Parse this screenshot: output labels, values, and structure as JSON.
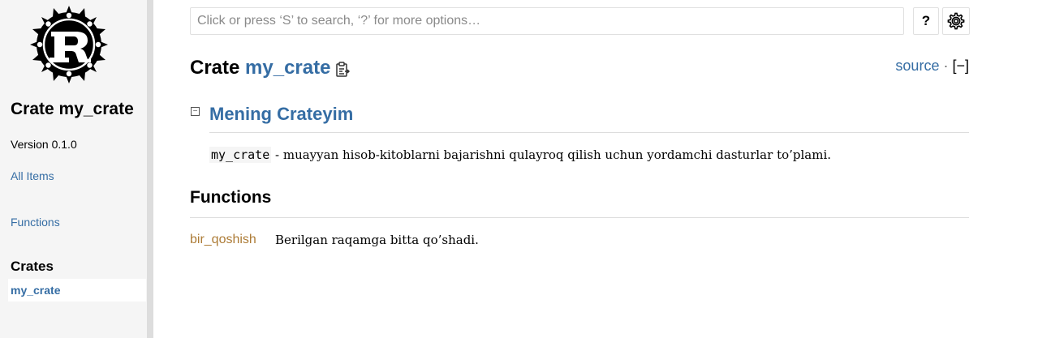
{
  "sidebar": {
    "logo_icon": "rust-logo-icon",
    "title": "Crate my_crate",
    "version": "Version 0.1.0",
    "all_items": "All Items",
    "functions": "Functions",
    "crates_heading": "Crates",
    "current_crate": "my_crate"
  },
  "search": {
    "placeholder": "Click or press ‘S’ to search, ‘?’ for more options…",
    "value": ""
  },
  "toolbar": {
    "help_label": "?",
    "settings_icon": "gear-icon"
  },
  "header": {
    "kind": "Crate",
    "name": "my_crate",
    "copy_icon": "clipboard-icon",
    "source_label": "source",
    "separator": "·",
    "collapse_toggle": "[−]"
  },
  "docblock": {
    "toggle": "−",
    "heading": "Mening Crateyim",
    "code": "my_crate",
    "text": " - muayyan hisob-kitoblarni bajarishni qulayroq qilish uchun yordamchi dasturlar to’plami."
  },
  "functions_section": {
    "heading": "Functions",
    "items": [
      {
        "name": "bir_qoshish",
        "description": "Berilgan raqamga bitta qo’shadi."
      }
    ]
  },
  "colors": {
    "link": "#356da4",
    "function": "#ad7c37",
    "sidebar_bg": "#f5f5f5"
  }
}
